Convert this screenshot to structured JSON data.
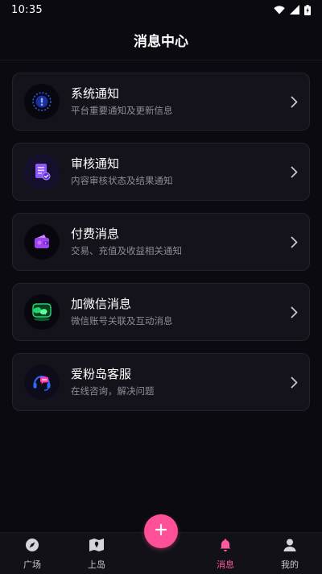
{
  "status_bar": {
    "time": "10:35"
  },
  "header": {
    "title": "消息中心"
  },
  "items": [
    {
      "title": "系统通知",
      "subtitle": "平台重要通知及更新信息",
      "icon": "system-notice-icon",
      "color": "#3a6cff"
    },
    {
      "title": "审核通知",
      "subtitle": "内容审核状态及结果通知",
      "icon": "review-notice-icon",
      "color": "#8e58ff"
    },
    {
      "title": "付费消息",
      "subtitle": "交易、充值及收益相关通知",
      "icon": "payment-icon",
      "color": "#b04fff"
    },
    {
      "title": "加微信消息",
      "subtitle": "微信账号关联及互动消息",
      "icon": "wechat-icon",
      "color": "#22d36b"
    },
    {
      "title": "爱粉岛客服",
      "subtitle": "在线咨询，解决问题",
      "icon": "customer-service-icon",
      "color": "#ff3fb0"
    }
  ],
  "tab_bar": {
    "tabs": [
      {
        "label": "广场",
        "icon": "compass-icon"
      },
      {
        "label": "上岛",
        "icon": "map-icon"
      },
      {
        "label": "消息",
        "icon": "bell-icon",
        "active": true
      },
      {
        "label": "我的",
        "icon": "user-icon"
      }
    ],
    "accent": "#ff5a9d",
    "fab_icon": "plus-icon"
  }
}
